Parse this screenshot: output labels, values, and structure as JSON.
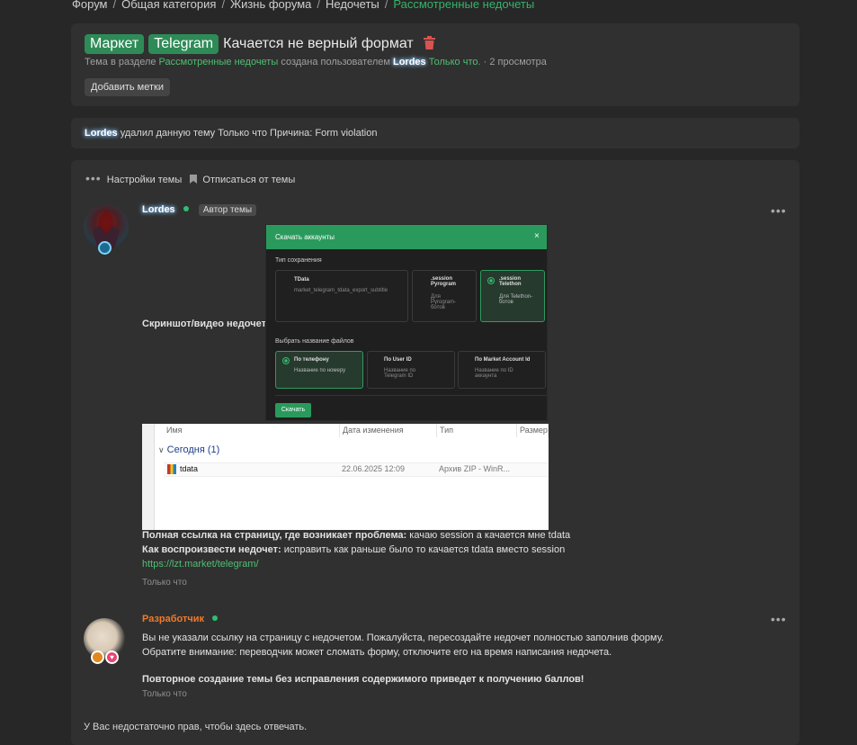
{
  "breadcrumb": {
    "items": [
      "Форум",
      "Общая категория",
      "Жизнь форума",
      "Недочеты"
    ],
    "active": "Рассмотренные недочеты",
    "separator": "/"
  },
  "thread": {
    "badges": [
      "Маркет",
      "Telegram"
    ],
    "title": "Качается не верный формат",
    "meta_prefix": "Тема в разделе",
    "meta_section": "Рассмотренные недочеты",
    "meta_created_by": "создана пользователем",
    "meta_user": "Lordes",
    "meta_time": "Только что.",
    "meta_views": "· 2 просмотра",
    "add_tags": "Добавить метки"
  },
  "deleted_notice": {
    "user": "Lordes",
    "text": "удалил данную тему Только что Причина: Form violation"
  },
  "toolbar": {
    "settings": "Настройки темы",
    "unsubscribe": "Отписаться от темы"
  },
  "post1": {
    "author": "Lordes",
    "author_badge": "Автор темы",
    "screenshot_label": "Скриншот/видео недочета:",
    "full_link_label": "Полная ссылка на страницу, где возникает проблема:",
    "full_link_value": "качаю session а качается мне tdata",
    "reproduce_label": "Как воспроизвести недочет:",
    "reproduce_value": "исправить как раньше было то качается tdata вместо session",
    "url": "https://lzt.market/telegram/",
    "time": "Только что"
  },
  "dialog": {
    "title": "Скачать аккаунты",
    "close": "×",
    "save_type_label": "Тип сохранения",
    "opt_tdata_title": "TData",
    "opt_tdata_desc": "market_telegram_tdata_export_subtitle",
    "opt_pyrogram_title": ".session Pyrogram",
    "opt_pyrogram_desc": "Для Pyrogram-ботов",
    "opt_telethon_title": ".session Telethon",
    "opt_telethon_desc": "Для Telethon-ботов",
    "filename_label": "Выбрать название файлов",
    "fn_phone_title": "По телефону",
    "fn_phone_desc": "Название по номеру",
    "fn_userid_title": "По User ID",
    "fn_userid_desc": "Название по Telegram ID",
    "fn_market_title": "По Market Account Id",
    "fn_market_desc": "Название по ID аккаунта",
    "download_button": "Скачать"
  },
  "explorer": {
    "columns": [
      "Имя",
      "Дата изменения",
      "Тип",
      "Размер"
    ],
    "group": "Сегодня (1)",
    "file": {
      "name": "tdata",
      "date": "22.06.2025 12:09",
      "type": "Архив ZIP - WinR..."
    }
  },
  "post2": {
    "author": "Разработчик",
    "line1": "Вы не указали ссылку на страницу с недочетом. Пожалуйста, пересоздайте недочет полностью заполнив форму.",
    "line2": "Обратите внимание: переводчик может сломать форму, отключите его на время написания недочета.",
    "line3": "Повторное создание темы без исправления содержимого приведет к получению баллов!",
    "time": "Только что"
  },
  "footer_notice": "У Вас недостаточно прав, чтобы здесь отвечать.",
  "colors": {
    "accent": "#2e8b57",
    "link": "#4fbf73",
    "background": "#272727",
    "panel": "#303030",
    "dev_name": "#f07a2b"
  }
}
